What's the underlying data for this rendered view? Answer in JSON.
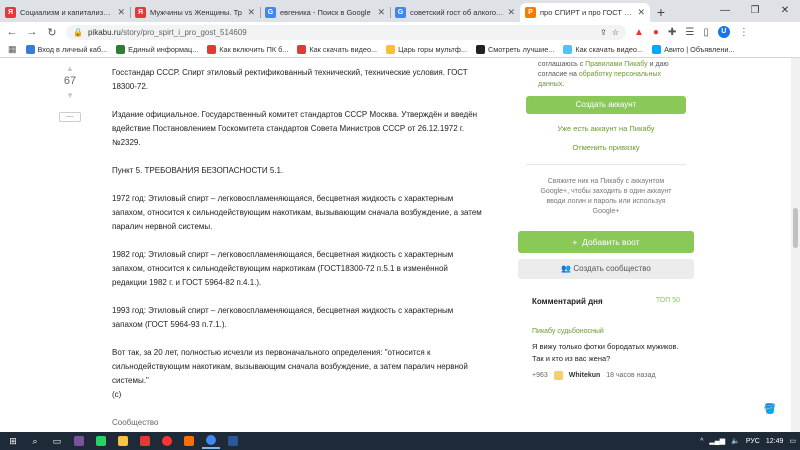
{
  "tabs": [
    {
      "title": "Социализм и капитализм (с",
      "favicon_color": "#e23a3a",
      "favicon_glyph": "Я"
    },
    {
      "title": "Мужчины vs Женщины. Тр",
      "favicon_color": "#e23a3a",
      "favicon_glyph": "Я"
    },
    {
      "title": "евгеника - Поиск в Google",
      "favicon_color": "#4285f4",
      "favicon_glyph": "G"
    },
    {
      "title": "советский гост об алкоголе",
      "favicon_color": "#4285f4",
      "favicon_glyph": "G"
    },
    {
      "title": "про СПИРТ и про ГОСТ | Пи",
      "favicon_color": "#f57c00",
      "favicon_glyph": "P",
      "active": true
    }
  ],
  "address_bar": {
    "domain": "pikabu.ru",
    "path": "/story/pro_spirt_i_pro_gost_514609"
  },
  "bookmarks": [
    {
      "label": "Вход в личный каб...",
      "color": "#3a7bd5"
    },
    {
      "label": "Единый информац...",
      "color": "#2e7d32"
    },
    {
      "label": "Как включить ПК б...",
      "color": "#e53935"
    },
    {
      "label": "Как скачать видео...",
      "color": "#e53935"
    },
    {
      "label": "Царь горы мультф...",
      "color": "#fbc02d"
    },
    {
      "label": "Смотреть лучшие...",
      "color": "#212121"
    },
    {
      "label": "Как скачать видео...",
      "color": "#4fc3f7"
    },
    {
      "label": "Авито | Объявлени...",
      "color": "#00aaff"
    }
  ],
  "post": {
    "rating": "67",
    "collapse_label": "—",
    "paragraphs": [
      "Госстандар СССР. Спирт этиловый ректификованный технический, технические условия. ГОСТ 18300-72.",
      "Издание официальное. Государственный комитет стандартов СССР Москва. Утверждён и введён вдействие Постановлением Госкомитета стандартов Совета Министров СССР от 26.12.1972 г. №2329.",
      "Пункт 5. ТРЕБОВАНИЯ БЕЗОПАСНОСТИ 5.1.",
      "1972 год: Этиловый спирт – легковоспламеняющаяся, бесцветная жидкость с характерным запахом, относится к сильнодействующим накотикам, вызывающим сначала возбуждение, а затем паралич нервной системы.",
      "1982 год: Этиловый спирт – легковоспламеняющаяся, бесцветная жидкость с характерным запахом, относится к сильнодействующим наркотикам (ГОСТ18300-72 п.5.1 в изменённой редакции 1982 г. и ГОСТ 5964-82 п.4.1.).",
      "1993 год: Этиловый спирт – легковоспламеняющаяся, бесцветная жидкость с характерным запахом (ГОСТ 5964-93 п.7.1.).",
      "Вот так, за 20 лет, полностью исчезли из первоначального определения: \"относится к сильнодействующим накотикам, вызывающим сначала возбуждение, а затем паралич нервной системы.\""
    ],
    "cite": "(с)",
    "community_label": "Сообщество"
  },
  "sidebar": {
    "legal_pre": "соглашаюсь с ",
    "legal_link1": "Правилами Пикабу",
    "legal_mid": " и даю согласие на ",
    "legal_link2": "обработку персональных данных",
    "legal_end": ".",
    "create_account": "Создать аккаунт",
    "have_account": "Уже есть аккаунт на Пикабу",
    "cancel_binding": "Отменить привязку",
    "google_note": "Свяжите ник на Пикабу с аккаунтом Google+, чтобы заходить в один аккаунт вводи логин и пароль или используя Google+",
    "add_post": "Добавить воот",
    "create_community": "Создать сообщество",
    "comment_of_day": {
      "title": "Комментарий дня",
      "top": "ТОП 50",
      "community": "Пикабу судьбоносный",
      "text": "Я вижу только фотки бородатых мужиков. Так и кто из вас жена?",
      "score": "+963",
      "user": "Whitekun",
      "time": "18 часов назад"
    }
  },
  "taskbar": {
    "lang": "РУС",
    "time": "12:49"
  }
}
